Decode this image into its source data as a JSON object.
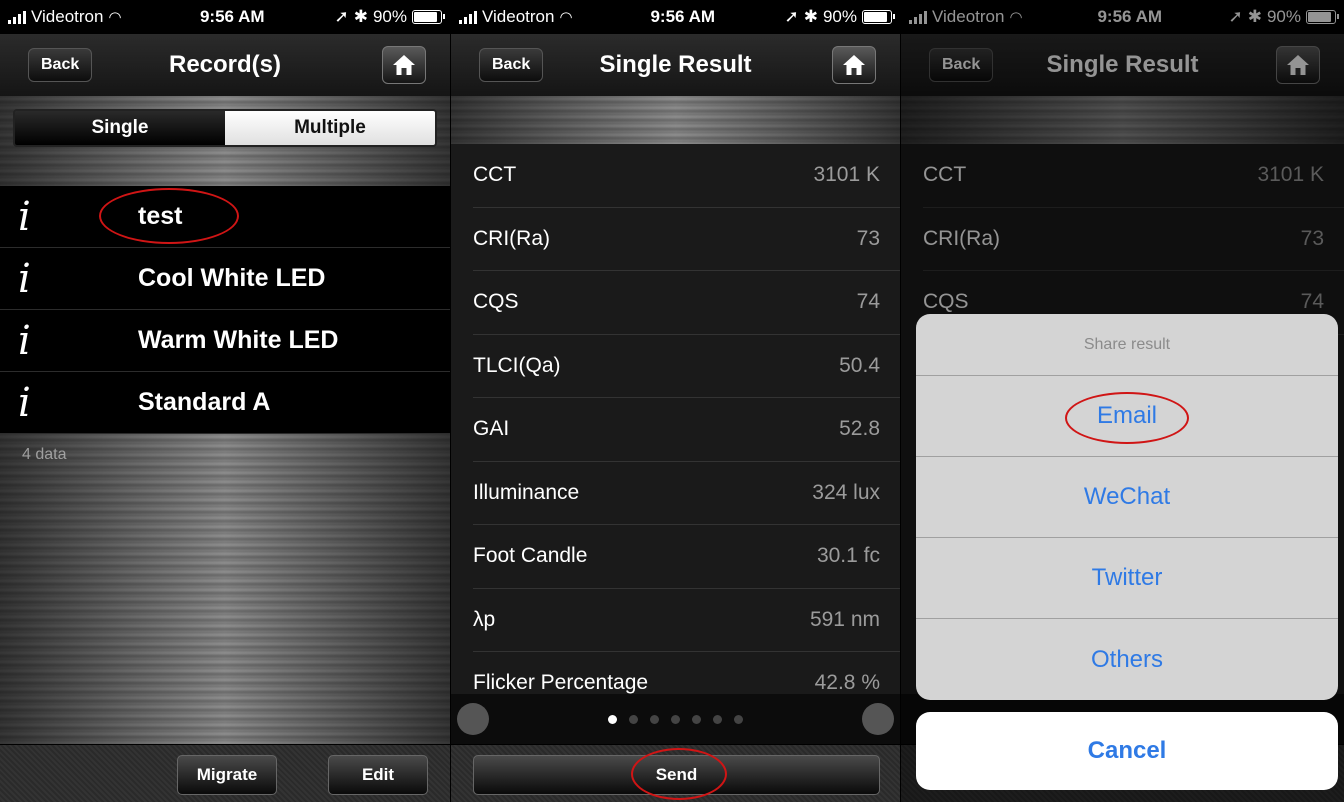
{
  "status": {
    "carrier": "Videotron",
    "time": "9:56 AM",
    "battery": "90%"
  },
  "screen1": {
    "nav": {
      "back": "Back",
      "title": "Record(s)"
    },
    "segments": [
      "Single",
      "Multiple"
    ],
    "records": [
      "test",
      "Cool White LED",
      "Warm White LED",
      "Standard A"
    ],
    "count": "4 data",
    "toolbar": {
      "migrate": "Migrate",
      "edit": "Edit"
    }
  },
  "screen2": {
    "nav": {
      "back": "Back",
      "title": "Single Result"
    },
    "results": [
      {
        "label": "CCT",
        "value": "3101 K"
      },
      {
        "label": "CRI(Ra)",
        "value": "73"
      },
      {
        "label": "CQS",
        "value": "74"
      },
      {
        "label": "TLCI(Qa)",
        "value": "50.4"
      },
      {
        "label": "GAI",
        "value": "52.8"
      },
      {
        "label": "Illuminance",
        "value": "324 lux"
      },
      {
        "label": "Foot Candle",
        "value": "30.1 fc"
      },
      {
        "label": "λp",
        "value": "591 nm"
      },
      {
        "label": "Flicker Percentage",
        "value": "42.8 %"
      }
    ],
    "pager": {
      "pages": 7,
      "active": 0
    },
    "send": "Send"
  },
  "screen3": {
    "nav": {
      "back": "Back",
      "title": "Single Result"
    },
    "results": [
      {
        "label": "CCT",
        "value": "3101 K"
      },
      {
        "label": "CRI(Ra)",
        "value": "73"
      },
      {
        "label": "CQS",
        "value": "74"
      }
    ],
    "sheet": {
      "title": "Share result",
      "options": [
        "Email",
        "WeChat",
        "Twitter",
        "Others"
      ],
      "cancel": "Cancel"
    }
  },
  "colors": {
    "accent": "#2f7ae5",
    "highlight": "#d01515"
  }
}
